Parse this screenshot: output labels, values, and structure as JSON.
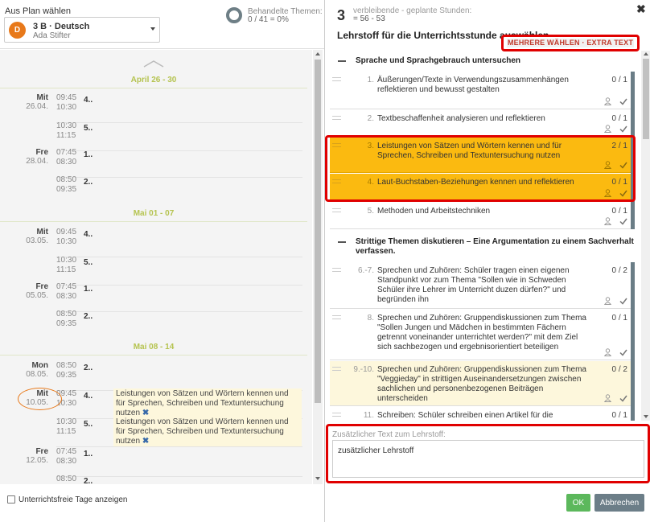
{
  "plan": {
    "label": "Aus Plan wählen",
    "avatar": "D",
    "class_subject": "3 B · Deutsch",
    "teacher": "Ada Stifter"
  },
  "topics": {
    "label": "Behandelte Themen:",
    "value": "0 / 41 = 0%"
  },
  "schedule": {
    "weeks": [
      "April 26 - 30",
      "Mai 01 - 07",
      "Mai 08 - 14"
    ],
    "slots": [
      {
        "day": "Mit",
        "date": "26.04.",
        "t1": "09:45",
        "t2": "10:30",
        "num": "4.."
      },
      {
        "day": "",
        "date": "",
        "t1": "10:30",
        "t2": "11:15",
        "num": "5.."
      },
      {
        "day": "Fre",
        "date": "28.04.",
        "t1": "07:45",
        "t2": "08:30",
        "num": "1.."
      },
      {
        "day": "",
        "date": "",
        "t1": "08:50",
        "t2": "09:35",
        "num": "2.."
      },
      {
        "day": "Mit",
        "date": "03.05.",
        "t1": "09:45",
        "t2": "10:30",
        "num": "4.."
      },
      {
        "day": "",
        "date": "",
        "t1": "10:30",
        "t2": "11:15",
        "num": "5.."
      },
      {
        "day": "Fre",
        "date": "05.05.",
        "t1": "07:45",
        "t2": "08:30",
        "num": "1.."
      },
      {
        "day": "",
        "date": "",
        "t1": "08:50",
        "t2": "09:35",
        "num": "2.."
      },
      {
        "day": "Mon",
        "date": "08.05.",
        "t1": "08:50",
        "t2": "09:35",
        "num": "2.."
      },
      {
        "day": "Mit",
        "date": "10.05.",
        "t1": "09:45",
        "t2": "10:30",
        "num": "4..",
        "assigned": "Leistungen von Sätzen und Wörtern kennen und für Sprechen, Schreiben und Textuntersuchung nutzen"
      },
      {
        "day": "",
        "date": "",
        "t1": "10:30",
        "t2": "11:15",
        "num": "5..",
        "assigned": "Leistungen von Sätzen und Wörtern kennen und für Sprechen, Schreiben und Textuntersuchung nutzen"
      },
      {
        "day": "Fre",
        "date": "12.05.",
        "t1": "07:45",
        "t2": "08:30",
        "num": "1.."
      },
      {
        "day": "",
        "date": "",
        "t1": "08:50",
        "t2": "",
        "num": "2.."
      }
    ]
  },
  "footer": {
    "free_days_label": "Unterrichtsfreie Tage anzeigen"
  },
  "header": {
    "hours_number": "3",
    "hours_label": "verbleibende - geplante Stunden:",
    "hours_range": "= 56 - 53",
    "title": "Lehrstoff für die Unterrichtsstunde auswählen",
    "extra_button": "MEHRERE WÄHLEN · EXTRA TEXT"
  },
  "sections": [
    {
      "title": "Sprache und Sprachgebrauch untersuchen",
      "items": [
        {
          "num": "1.",
          "text": "Äußerungen/Texte in Verwendungszusammenhängen reflektieren und bewusst gestalten",
          "count": "0 / 1"
        },
        {
          "num": "2.",
          "text": "Textbeschaffenheit analysieren und reflektieren",
          "count": "0 / 1"
        },
        {
          "num": "3.",
          "text": "Leistungen von Sätzen und Wörtern kennen und für Sprechen, Schreiben und Textuntersuchung nutzen",
          "count": "2 / 1"
        },
        {
          "num": "4.",
          "text": "Laut-Buchstaben-Beziehungen kennen und reflektieren",
          "count": "0 / 1"
        },
        {
          "num": "5.",
          "text": "Methoden und Arbeitstechniken",
          "count": "0 / 1"
        }
      ]
    },
    {
      "title": "Strittige Themen diskutieren – Eine Argumentation zu einem Sachverhalt verfassen.",
      "items": [
        {
          "num": "6.-7.",
          "text": "Sprechen und Zuhören: Schüler tragen einen eigenen Standpunkt vor zum Thema \"Sollen wie in Schweden Schüler ihre Lehrer im Unterricht duzen dürfen?\" und begründen ihn",
          "count": "0 / 2"
        },
        {
          "num": "8.",
          "text": "Sprechen und Zuhören: Gruppendiskussionen zum Thema \"Sollen Jungen und Mädchen in bestimmten Fächern getrennt voneinander unterrichtet werden?\" mit dem Ziel sich sachbezogen und ergebnisorientiert beteiligen",
          "count": "0 / 1"
        },
        {
          "num": "9.-10.",
          "text": "Sprechen und Zuhören: Gruppendiskussionen zum Thema \"Veggieday\" in strittigen Auseinandersetzungen zwischen sachlichen und personenbezogenen Beiträgen unterscheiden",
          "count": "0 / 2"
        },
        {
          "num": "11.",
          "text": "Schreiben: Schüler schreiben einen Artikel für die Schülerzeitschrift über Sachverhalte (Missstand, Ereignis an",
          "count": "0 / 1"
        }
      ]
    }
  ],
  "extra": {
    "label": "Zusätzlicher Text zum Lehrstoff:",
    "value": "zusätzlicher Lehrstoff"
  },
  "buttons": {
    "ok": "OK",
    "cancel": "Abbrechen"
  },
  "colors": {
    "accent_orange": "#e8791a",
    "week_green": "#b5c34f",
    "highlight_yellow": "#fbba10",
    "annotation_red": "#e00000",
    "ok_green": "#5cb85c",
    "cancel_gray": "#6c7e88"
  }
}
